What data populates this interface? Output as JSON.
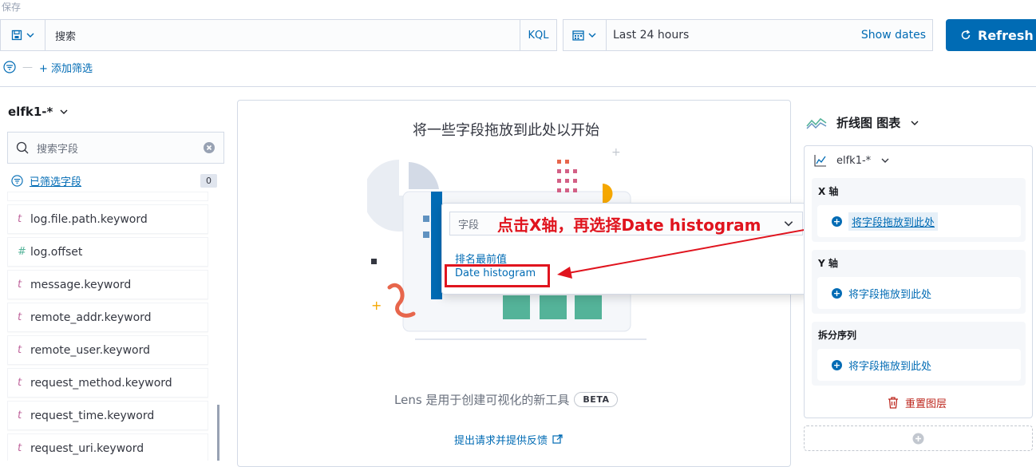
{
  "top": {
    "save_label": "保存"
  },
  "query": {
    "placeholder": "搜索",
    "language": "KQL"
  },
  "date": {
    "range": "Last 24 hours",
    "show_dates": "Show dates"
  },
  "refresh": {
    "label": "Refresh"
  },
  "filters": {
    "add_label": "+ 添加筛选"
  },
  "sidebar": {
    "index_pattern": "elfk1-*",
    "search_placeholder": "搜索字段",
    "selected_fields_label": "已筛选字段",
    "selected_count": "0",
    "fields": [
      {
        "type": "t",
        "name": "log.file.path.keyword"
      },
      {
        "type": "#",
        "name": "log.offset"
      },
      {
        "type": "t",
        "name": "message.keyword"
      },
      {
        "type": "t",
        "name": "remote_addr.keyword"
      },
      {
        "type": "t",
        "name": "remote_user.keyword"
      },
      {
        "type": "t",
        "name": "request_method.keyword"
      },
      {
        "type": "t",
        "name": "request_time.keyword"
      },
      {
        "type": "t",
        "name": "request_uri.keyword"
      }
    ]
  },
  "workspace": {
    "title": "将一些字段拖放到此处以开始",
    "lens_text": "Lens 是用于创建可视化的新工具",
    "beta": "BETA",
    "feedback": "提出请求并提供反馈"
  },
  "popover": {
    "select_label": "字段",
    "options": [
      "排名最前值",
      "Date histogram"
    ]
  },
  "annotation": {
    "text": "点击X轴，再选择Date histogram"
  },
  "config": {
    "chart_type": "折线图 图表",
    "layer_index": "elfk1-*",
    "x_axis": {
      "label": "X 轴",
      "drop": "将字段拖放到此处"
    },
    "y_axis": {
      "label": "Y 轴",
      "drop": "将字段拖放到此处"
    },
    "split": {
      "label": "拆分序列",
      "drop": "将字段拖放到此处"
    },
    "reset": "重置图层"
  },
  "colors": {
    "primary": "#006bb4",
    "annotation_red": "#e0141e",
    "danger": "#bd271e"
  }
}
